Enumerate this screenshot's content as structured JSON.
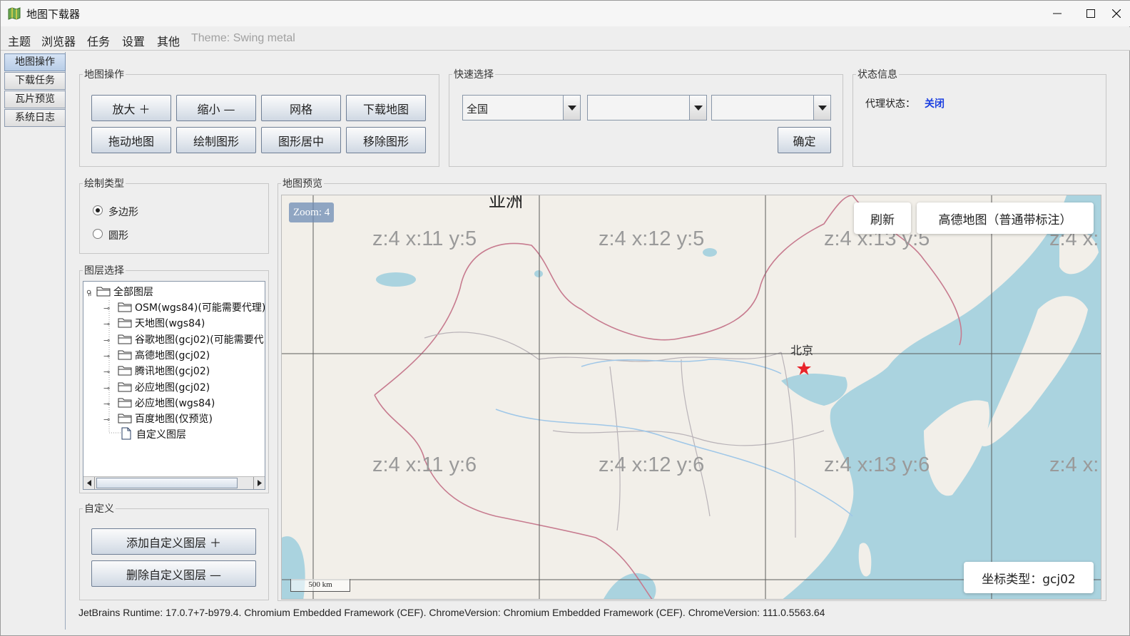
{
  "window": {
    "title": "地图下载器"
  },
  "menu": {
    "items": [
      "主题",
      "浏览器",
      "任务",
      "设置",
      "其他"
    ],
    "theme": "Theme: Swing metal"
  },
  "tabs": [
    "地图操作",
    "下载任务",
    "瓦片预览",
    "系统日志"
  ],
  "map_ops": {
    "title": "地图操作",
    "buttons": [
      "放大 ＋",
      "缩小 —",
      "网格",
      "下载地图",
      "拖动地图",
      "绘制图形",
      "图形居中",
      "移除图形"
    ]
  },
  "quick": {
    "title": "快速选择",
    "combo1": "全国",
    "combo2": "",
    "combo3": "",
    "confirm": "确定"
  },
  "status": {
    "title": "状态信息",
    "proxy_label": "代理状态：",
    "proxy_value": "关闭",
    "proxy_color": "#1a3ee0"
  },
  "draw": {
    "title": "绘制类型",
    "options": [
      "多边形",
      "圆形"
    ],
    "selected": "多边形"
  },
  "layers": {
    "title": "图层选择",
    "root": "全部图层",
    "items": [
      "OSM(wgs84)(可能需要代理)",
      "天地图(wgs84)",
      "谷歌地图(gcj02)(可能需要代",
      "高德地图(gcj02)",
      "腾讯地图(gcj02)",
      "必应地图(gcj02)",
      "必应地图(wgs84)",
      "百度地图(仅预览)"
    ],
    "leaf": "自定义图层"
  },
  "custom": {
    "title": "自定义",
    "add": "添加自定义图层 ＋",
    "remove": "删除自定义图层 —"
  },
  "preview": {
    "title": "地图预览",
    "zoom": "Zoom: 4",
    "refresh": "刷新",
    "source": "高德地图（普通带标注）",
    "coord_type": "坐标类型：gcj02",
    "scale": "500 km",
    "city": "北京",
    "top_label": "亚洲",
    "tiles": [
      "z:4 x:11 y:5",
      "z:4 x:12 y:5",
      "z:4 x:13 y:5",
      "z:4 x:",
      "z:4 x:11 y:6",
      "z:4 x:12 y:6",
      "z:4 x:13 y:6",
      "z:4 x:"
    ]
  },
  "footer": "JetBrains Runtime: 17.0.7+7-b979.4. Chromium Embedded Framework (CEF). ChromeVersion: Chromium Embedded Framework (CEF). ChromeVersion: 111.0.5563.64"
}
